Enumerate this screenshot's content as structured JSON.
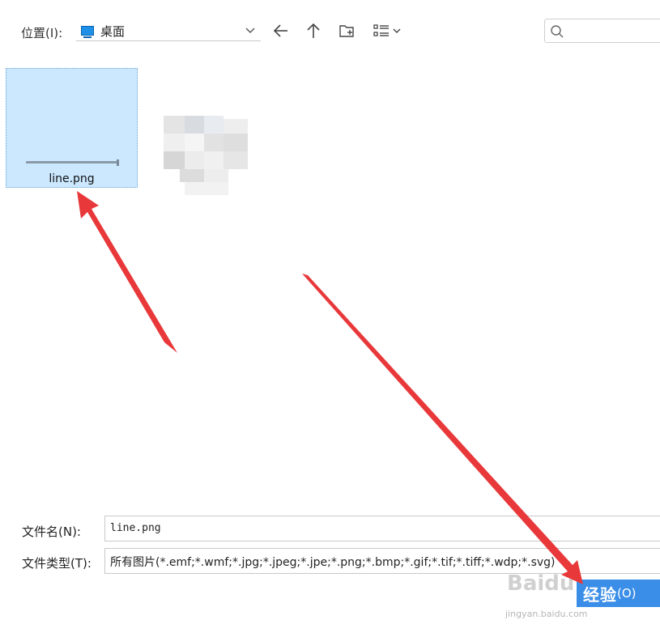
{
  "toolbar": {
    "location_label": "位置(I):",
    "location_value": "桌面",
    "search_placeholder": ""
  },
  "files": [
    {
      "name": "line.png",
      "selected": true
    },
    {
      "name": "",
      "selected": false
    }
  ],
  "form": {
    "filename_label": "文件名(N):",
    "filename_value": "line.png",
    "filetype_label": "文件类型(T):",
    "filetype_value": "所有图片(*.emf;*.wmf;*.jpg;*.jpeg;*.jpe;*.png;*.bmp;*.gif;*.tif;*.tiff;*.wdp;*.svg)"
  },
  "open_button": {
    "label_main": "经验",
    "label_shortcut": "(O)"
  },
  "watermark": {
    "logo": "Baidu",
    "sub": "jingyan.baidu.com"
  },
  "colors": {
    "selection": "#cce8ff",
    "button": "#3b8ee8",
    "arrow": "#e8383a"
  }
}
